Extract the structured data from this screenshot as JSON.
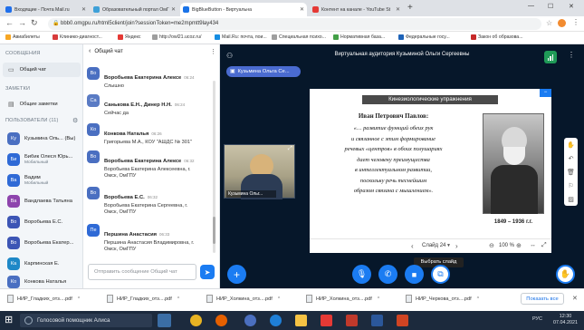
{
  "browser": {
    "tabs": [
      {
        "title": "Входящие - Почта Mail.ru",
        "color": "#1f6feb",
        "active": false
      },
      {
        "title": "Образовательный портал ОмГ",
        "color": "#3ea0d8",
        "active": false
      },
      {
        "title": "BigBlueButton - Виртуальна",
        "color": "#1a73e8",
        "active": true
      },
      {
        "title": "Контент на канале - YouTube St",
        "color": "#e53935",
        "active": false
      }
    ],
    "url": "bbb0.omgpu.ru/html5client/join?sessionToken=me2mpmtt9lay434",
    "bookmarks": [
      "Авиабилеты",
      "Клинико-диагност...",
      "Яндекс",
      "http://owl21.ucoz.ru/",
      "Mail.Ru: почта, пои...",
      "Специальная психо...",
      "Нормативная база...",
      "Федеральные госу...",
      "Закон об образова..."
    ]
  },
  "users_panel": {
    "messages_header": "СООБЩЕНИЯ",
    "public_chat": "Общий чат",
    "notes_header": "ЗАМЕТКИ",
    "shared_notes": "Общие заметки",
    "users_header": "ПОЛЬЗОВАТЕЛИ (11)",
    "users": [
      {
        "initials": "Ку",
        "name": "Кузьмина Оль... (Вы)",
        "sub": ""
      },
      {
        "initials": "Би",
        "name": "Бибик Олеся Юрь...",
        "sub": "Мобильный"
      },
      {
        "initials": "Ва",
        "name": "Вадим",
        "sub": "Мобильный"
      },
      {
        "initials": "Ва",
        "name": "Вандлаева Татьяна",
        "sub": ""
      },
      {
        "initials": "Во",
        "name": "Воробьева Е.С.",
        "sub": ""
      },
      {
        "initials": "Во",
        "name": "Воробьева Екатер...",
        "sub": ""
      },
      {
        "initials": "Ка",
        "name": "Карпинская Е.",
        "sub": ""
      },
      {
        "initials": "Ко",
        "name": "Конкова Наталья",
        "sub": ""
      }
    ]
  },
  "chat": {
    "title": "Общий чат",
    "input_placeholder": "Отправить сообщение Общий чат",
    "messages": [
      {
        "initials": "Во",
        "name": "Воробьева Екатерина Алексе",
        "time": "06:24",
        "lines": [
          "Слышно"
        ]
      },
      {
        "initials": "Са",
        "name": "Санькова Е.Н., Динер Н.Н.",
        "time": "06:24",
        "lines": [
          "Сейчас да"
        ]
      },
      {
        "initials": "Ко",
        "name": "Конкова Наталья",
        "time": "06:26",
        "lines": [
          "Григорьева М.А., КОУ \"АШДС № 301\""
        ]
      },
      {
        "initials": "Во",
        "name": "Воробьева Екатерина Алексе",
        "time": "06:32",
        "lines": [
          "Воробьева Екатерина Алексеевна, г.",
          "Омск, ОмГПУ"
        ]
      },
      {
        "initials": "Во",
        "name": "Воробьева Е.С.",
        "time": "06:32",
        "lines": [
          "Воробьева Екатерина Сергеевна, г.",
          "Омск, ОмГПУ"
        ]
      },
      {
        "initials": "Пе",
        "name": "Першина Анастасия",
        "time": "06:33",
        "lines": [
          "Першина Анастасия Владимировна, г.",
          "Омск, ОмГПУ"
        ]
      }
    ]
  },
  "main": {
    "room_title": "Виртуальная аудитория Кузьминой Ольги Сергеевны",
    "presenter_tag": "Кузьмина Ольга Се...",
    "webcam_name": "Кузьмина Ольг...",
    "slide": {
      "header": "Кинезиологические упражнения",
      "quote_author": "Иван Петрович Павлов:",
      "quote_lines": [
        "«… развитие функций обеих рук",
        "и связанное с этим формирование",
        "речевых «центров» в обоих полушариях",
        "дает человеку преимущества",
        "в интеллектуальном развитии,",
        "поскольку речь теснейшим",
        "образом связана с мышлением»."
      ],
      "portrait_caption": "1849 – 1936 г.г."
    },
    "slide_nav": {
      "label": "Слайд 24",
      "zoom": "100 %"
    },
    "tooltip": "Выбрать слайд"
  },
  "downloads": {
    "items": [
      "НИР_Гладких_отз....pdf",
      "НИР_Гладких_отз....pdf",
      "НИР_Холкина_отз....pdf",
      "НИР_Холкина_отз....pdf",
      "НИР_Черкова_отз....pdf"
    ],
    "show_all": "Показать все"
  },
  "taskbar": {
    "assistant": "Голосовой помощник Алиса",
    "lang": "РУС",
    "time": "12:30",
    "date": "07.04.2021"
  }
}
